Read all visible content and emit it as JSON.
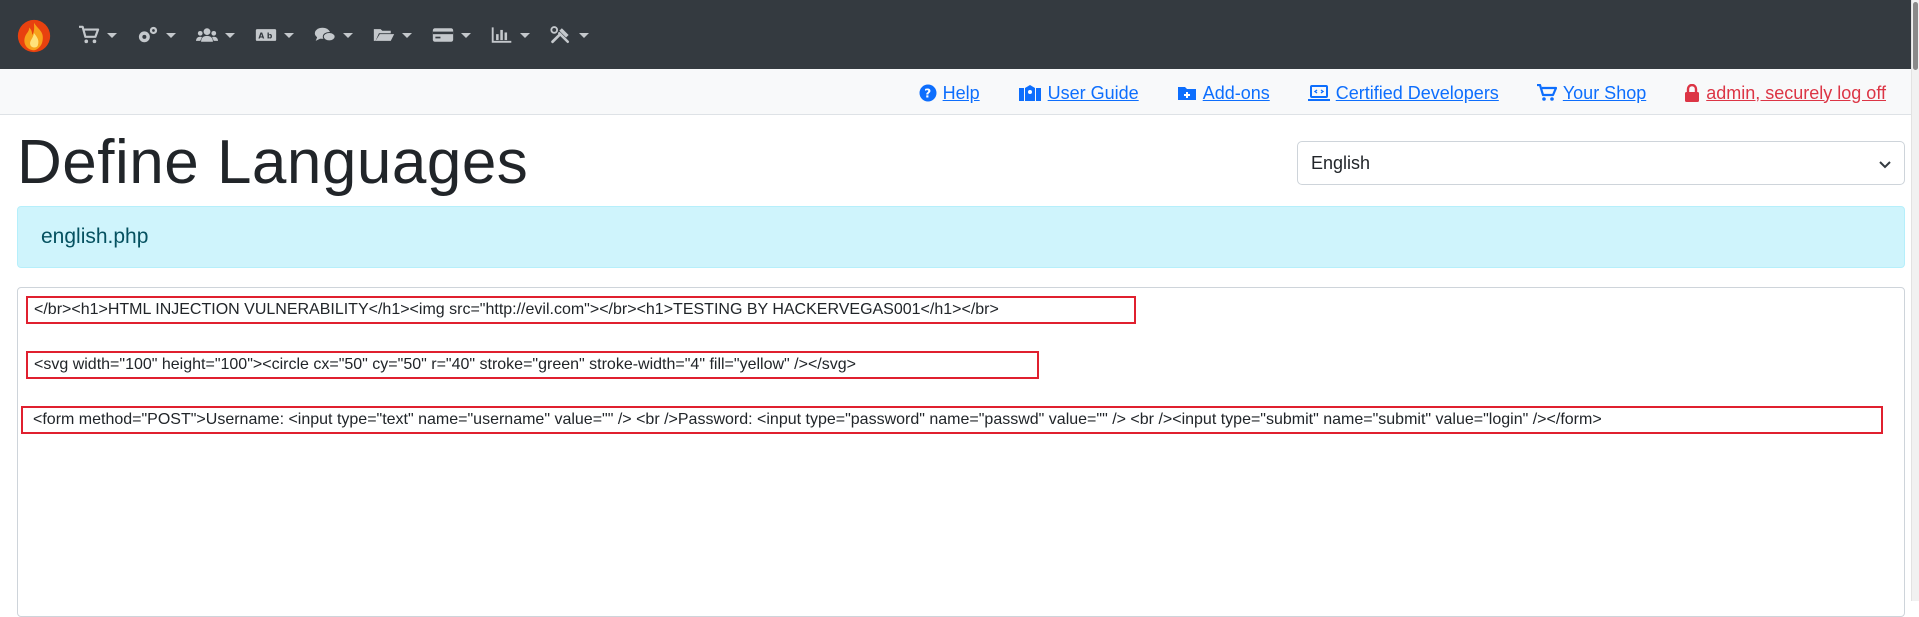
{
  "navbar": {
    "logo": "flame-logo",
    "menus": [
      {
        "icon": "cart-icon"
      },
      {
        "icon": "gears-icon"
      },
      {
        "icon": "users-icon"
      },
      {
        "icon": "language-icon"
      },
      {
        "icon": "comments-icon"
      },
      {
        "icon": "folder-icon"
      },
      {
        "icon": "credit-card-icon"
      },
      {
        "icon": "chart-icon"
      },
      {
        "icon": "tools-icon"
      }
    ]
  },
  "linkbar": {
    "help": "Help",
    "user_guide": "User Guide",
    "addons": "Add-ons",
    "certified_developers": "Certified Developers",
    "your_shop": "Your Shop",
    "logoff": "admin, securely log off"
  },
  "page": {
    "title": "Define Languages",
    "language_selected": "English",
    "file_name": "english.php"
  },
  "editor": {
    "lines": [
      "</br><h1>HTML INJECTION VULNERABILITY</h1><img src=\"http://evil.com\"></br><h1>TESTING BY HACKERVEGAS001</h1></br>",
      "<svg width=\"100\" height=\"100\"><circle cx=\"50\" cy=\"50\" r=\"40\" stroke=\"green\" stroke-width=\"4\" fill=\"yellow\" /></svg>",
      "<form method=\"POST\">Username: <input type=\"text\" name=\"username\" value=\"\" /> <br />Password: <input type=\"password\" name=\"passwd\" value=\"\" /> <br /><input type=\"submit\" name=\"submit\" value=\"login\" /></form>"
    ]
  },
  "colors": {
    "navbar_bg": "#343a40",
    "link": "#0d6efd",
    "danger": "#dc3545",
    "banner_bg": "#cff4fc",
    "highlight_border": "#e0202f"
  }
}
